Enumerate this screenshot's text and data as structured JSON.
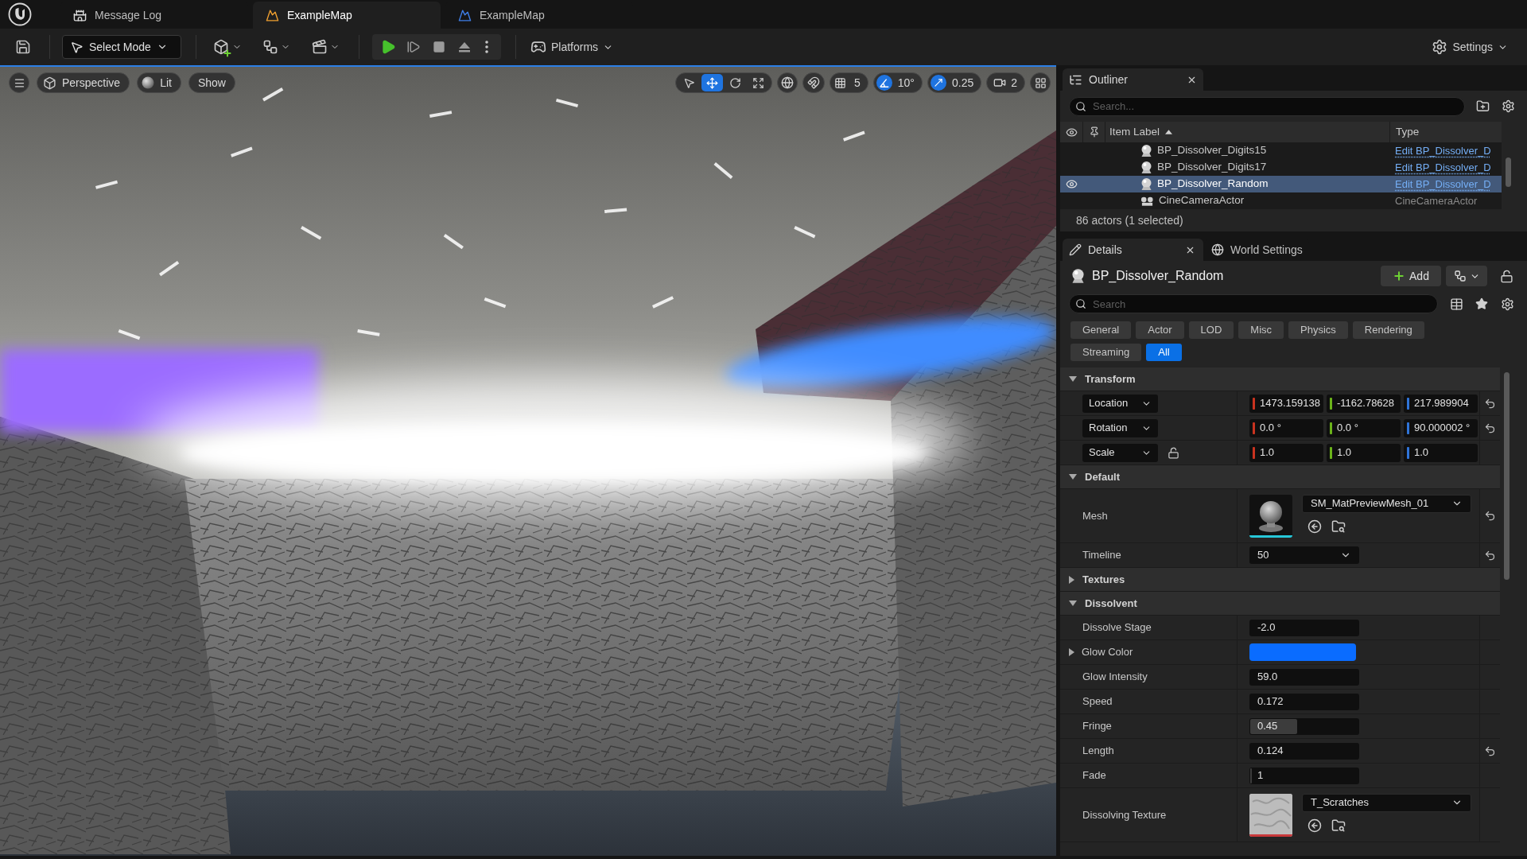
{
  "tabs": [
    {
      "kind": "log",
      "label": "Message Log",
      "selected": false
    },
    {
      "kind": "level",
      "label": "ExampleMap",
      "selected": true
    },
    {
      "kind": "blueprint",
      "label": "ExampleMap",
      "selected": false
    }
  ],
  "toolbar": {
    "mode": "Select Mode",
    "platforms": "Platforms",
    "settings": "Settings"
  },
  "viewport": {
    "view": "Perspective",
    "lighting": "Lit",
    "show": "Show",
    "tools": [
      {
        "kind": "select",
        "selected": false
      },
      {
        "kind": "move",
        "selected": true
      },
      {
        "kind": "rotate",
        "selected": false
      },
      {
        "kind": "scale",
        "selected": false
      }
    ],
    "snaps": [
      {
        "kind": "grid",
        "on": false,
        "value": "5"
      },
      {
        "kind": "angle",
        "on": true,
        "value": "10°"
      },
      {
        "kind": "scale",
        "on": true,
        "value": "0.25"
      }
    ],
    "camera_speed": "2"
  },
  "outliner": {
    "title": "Outliner",
    "search": {
      "placeholder": "Search..."
    },
    "columns": [
      {
        "label": "Item Label",
        "sorted": true
      },
      {
        "label": "Type",
        "sorted": false
      }
    ],
    "rows": [
      {
        "kind": "blueprint",
        "label": "BP_Dissolver_Digits15",
        "type": "Edit BP_Dissolver_D",
        "selected": false
      },
      {
        "kind": "blueprint",
        "label": "BP_Dissolver_Digits17",
        "type": "Edit BP_Dissolver_D",
        "selected": false
      },
      {
        "kind": "blueprint",
        "label": "BP_Dissolver_Random",
        "type": "Edit BP_Dissolver_D",
        "selected": true
      },
      {
        "kind": "camera",
        "label": "CineCameraActor",
        "type": "CineCameraActor",
        "selected": false
      }
    ],
    "status": "86 actors (1 selected)"
  },
  "details": {
    "tabs": [
      {
        "kind": "details",
        "label": "Details",
        "selected": true
      },
      {
        "kind": "world",
        "label": "World Settings",
        "selected": false
      }
    ],
    "actor": "BP_Dissolver_Random",
    "add_button": "Add",
    "search": {
      "placeholder": "Search"
    },
    "filters": [
      {
        "label": "General",
        "selected": false
      },
      {
        "label": "Actor",
        "selected": false
      },
      {
        "label": "LOD",
        "selected": false
      },
      {
        "label": "Misc",
        "selected": false
      },
      {
        "label": "Physics",
        "selected": false
      },
      {
        "label": "Rendering",
        "selected": false
      },
      {
        "label": "Streaming",
        "selected": false
      },
      {
        "label": "All",
        "selected": true
      }
    ],
    "sections": [
      {
        "title": "Transform",
        "expanded": true,
        "properties": [
          {
            "kind": "vector",
            "label": "Location",
            "values": [
              "1473.159138",
              "-1162.78628",
              "217.989904"
            ],
            "resettable": true
          },
          {
            "kind": "vector",
            "label": "Rotation",
            "values": [
              "0.0 °",
              "0.0 °",
              "90.000002 °"
            ],
            "resettable": true
          },
          {
            "kind": "vector",
            "label": "Scale",
            "values": [
              "1.0",
              "1.0",
              "1.0"
            ],
            "locked": false,
            "resettable": false
          }
        ]
      },
      {
        "title": "Default",
        "expanded": true,
        "properties": [
          {
            "kind": "mesh",
            "label": "Mesh",
            "value": "SM_MatPreviewMesh_01",
            "resettable": true
          },
          {
            "kind": "dropdown",
            "label": "Timeline",
            "value": "50",
            "resettable": true
          }
        ]
      },
      {
        "title": "Textures",
        "expanded": false
      },
      {
        "title": "Dissolvent",
        "expanded": true,
        "properties": [
          {
            "kind": "number",
            "label": "Dissolve Stage",
            "value": "-2.0",
            "resettable": false
          },
          {
            "kind": "color",
            "label": "Glow Color",
            "color": "#0a6cff",
            "expanded": false,
            "resettable": false
          },
          {
            "kind": "number",
            "label": "Glow Intensity",
            "value": "59.0",
            "resettable": false
          },
          {
            "kind": "number",
            "label": "Speed",
            "value": "0.172",
            "resettable": false
          },
          {
            "kind": "slider",
            "label": "Fringe",
            "value": "0.45",
            "level": 0.43,
            "resettable": false
          },
          {
            "kind": "number",
            "label": "Length",
            "value": "0.124",
            "resettable": true
          },
          {
            "kind": "slider",
            "label": "Fade",
            "value": "1",
            "level": 0.01,
            "resettable": false
          },
          {
            "kind": "texture",
            "label": "Dissolving Texture",
            "value": "T_Scratches",
            "resettable": false
          }
        ]
      }
    ]
  }
}
